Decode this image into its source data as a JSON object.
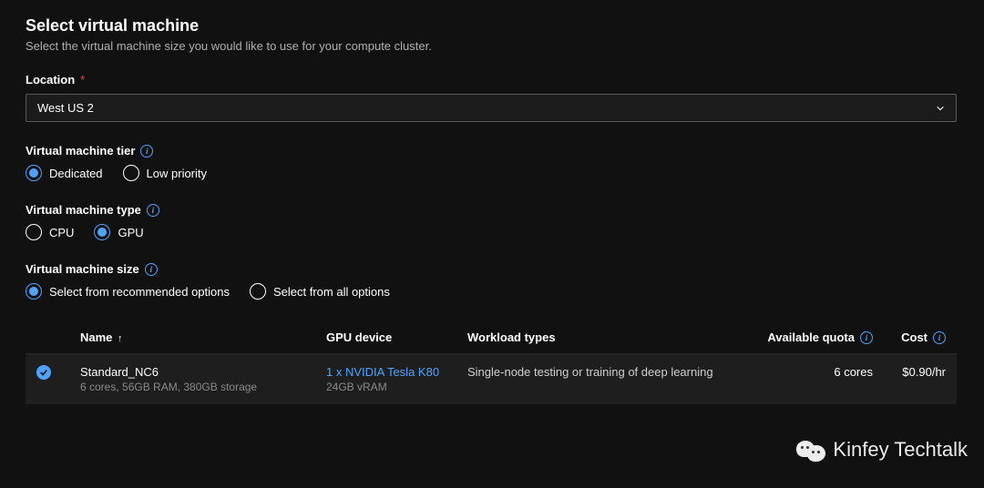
{
  "header": {
    "title": "Select virtual machine",
    "subtitle": "Select the virtual machine size you would like to use for your compute cluster."
  },
  "location": {
    "label": "Location",
    "required": "*",
    "value": "West US 2"
  },
  "tier": {
    "label": "Virtual machine tier",
    "options": {
      "dedicated": "Dedicated",
      "low_priority": "Low priority"
    },
    "selected": "dedicated"
  },
  "type": {
    "label": "Virtual machine type",
    "options": {
      "cpu": "CPU",
      "gpu": "GPU"
    },
    "selected": "gpu"
  },
  "size": {
    "label": "Virtual machine size",
    "options": {
      "recommended": "Select from recommended options",
      "all": "Select from all options"
    },
    "selected": "recommended"
  },
  "table": {
    "headers": {
      "name": "Name",
      "gpu": "GPU device",
      "workload": "Workload types",
      "quota": "Available quota",
      "cost": "Cost"
    },
    "rows": [
      {
        "selected": true,
        "name": "Standard_NC6",
        "specs": "6 cores, 56GB RAM, 380GB storage",
        "gpu": "1 x NVIDIA Tesla K80",
        "gpu_sub": "24GB vRAM",
        "workload": "Single-node testing or training of deep learning",
        "quota": "6 cores",
        "cost": "$0.90/hr"
      }
    ]
  },
  "watermark": "Kinfey Techtalk"
}
